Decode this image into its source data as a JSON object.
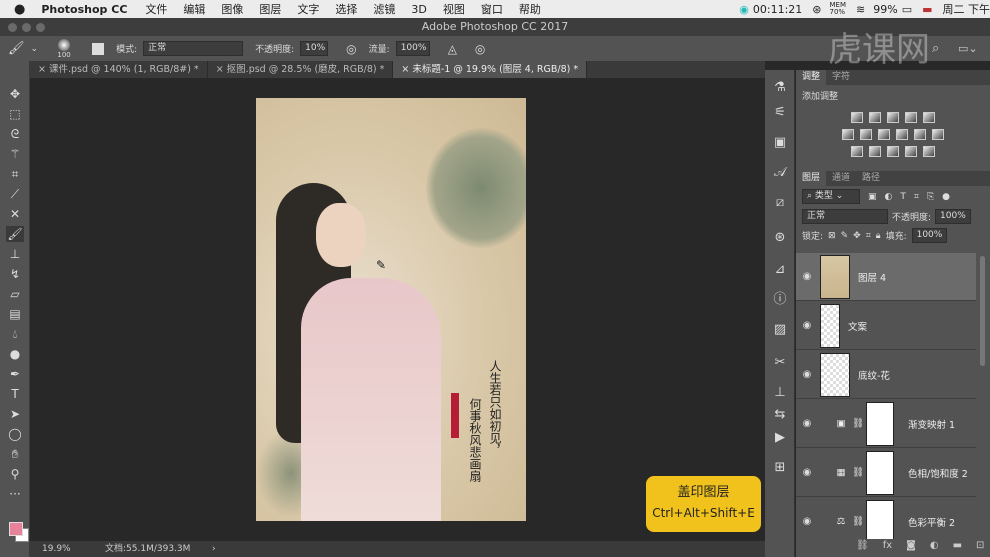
{
  "menubar": {
    "app": "Photoshop CC",
    "items": [
      "文件",
      "编辑",
      "图像",
      "图层",
      "文字",
      "选择",
      "滤镜",
      "3D",
      "视图",
      "窗口",
      "帮助"
    ],
    "time": "00:11:21",
    "mem_label": "MEM",
    "mem_value": "70%",
    "battery": "99%",
    "date": "周二 下午"
  },
  "window": {
    "title": "Adobe Photoshop CC 2017"
  },
  "options": {
    "brush_size": "100",
    "mode_label": "模式:",
    "mode_value": "正常",
    "opacity_label": "不透明度:",
    "opacity_value": "10%",
    "flow_label": "流量:",
    "flow_value": "100%"
  },
  "tabs": [
    {
      "label": "课件.psd @ 140% (1, RGB/8#) *"
    },
    {
      "label": "抠图.psd @ 28.5% (磨皮, RGB/8) *"
    },
    {
      "label": "未标题-1 @ 19.9% (图层 4, RGB/8) *"
    }
  ],
  "status": {
    "zoom": "19.9%",
    "doc": "文档:55.1M/393.3M"
  },
  "canvas_text": {
    "line1": "人生若只如初见，",
    "line2": "何事秋风悲画扇"
  },
  "watermark": "虎课网",
  "adjust_panel": {
    "tabs": [
      "调整",
      "字符"
    ],
    "heading": "添加调整"
  },
  "layers_panel": {
    "tabs": [
      "图层",
      "通道",
      "路径"
    ],
    "filter": "类型",
    "blend": "正常",
    "opacity_label": "不透明度:",
    "opacity": "100%",
    "lock_label": "锁定:",
    "fill_label": "填充:",
    "fill": "100%",
    "layers": [
      {
        "name": "图层 4"
      },
      {
        "name": "文案"
      },
      {
        "name": "底纹-花"
      },
      {
        "name": "渐变映射 1"
      },
      {
        "name": "色相/饱和度 2"
      },
      {
        "name": "色彩平衡 2"
      }
    ]
  },
  "shortcut_badge": {
    "title": "盖印图层",
    "keys": "Ctrl+Alt+Shift+E"
  },
  "colors": {
    "foreground": "#e8829a",
    "background": "#ffffff",
    "badge": "#f1c21b"
  }
}
